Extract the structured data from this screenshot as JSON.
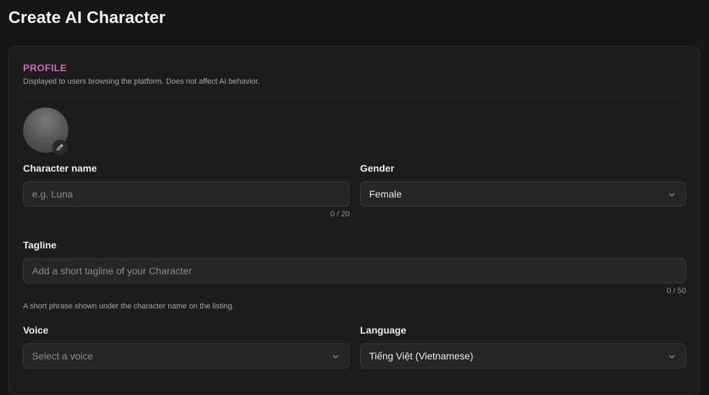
{
  "page": {
    "title": "Create AI Character"
  },
  "profile": {
    "title": "PROFILE",
    "description": "Displayed to users browsing the platform. Does not affect AI behavior.",
    "avatar_icon": "pencil-icon"
  },
  "character_name": {
    "label": "Character name",
    "placeholder": "e.g. Luna",
    "value": "",
    "counter": "0 / 20"
  },
  "gender": {
    "label": "Gender",
    "selected": "Female"
  },
  "tagline": {
    "label": "Tagline",
    "placeholder": "Add a short tagline of your Character",
    "value": "",
    "counter": "0 / 50",
    "hint": "A short phrase shown under the character name on the listing."
  },
  "voice": {
    "label": "Voice",
    "selected": "Select a voice"
  },
  "language": {
    "label": "Language",
    "selected": "Tiếng Việt (Vietnamese)"
  },
  "colors": {
    "accent": "#e45cc8",
    "background": "#161616",
    "card": "#1c1c1c",
    "field": "#262626"
  }
}
